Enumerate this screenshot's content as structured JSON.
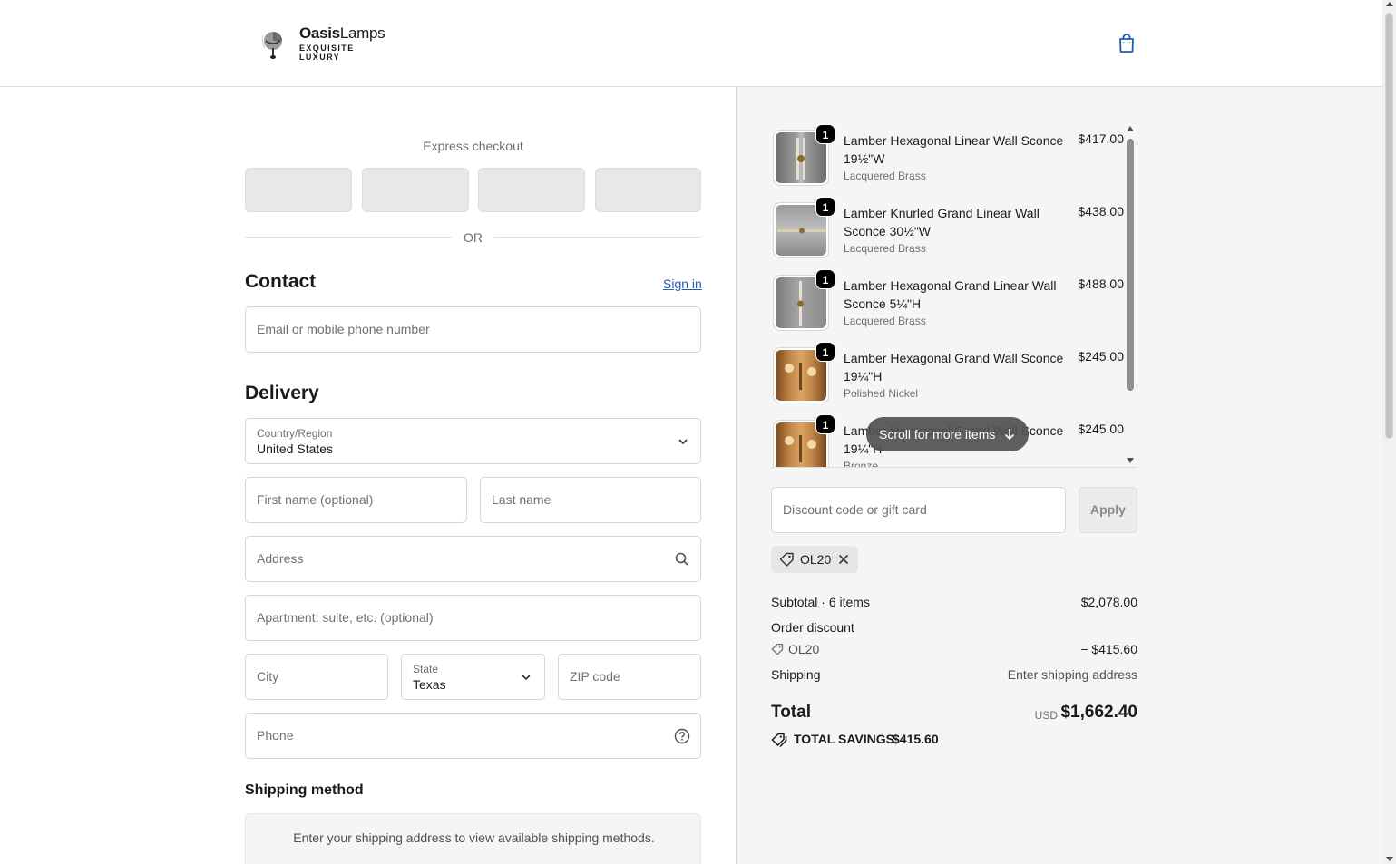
{
  "brand": {
    "name_bold": "Oasis",
    "name_light": "Lamps",
    "tagline_1": "EXQUISITE",
    "tagline_2": "LUXURY"
  },
  "express": {
    "label": "Express checkout",
    "or": "OR"
  },
  "contact": {
    "title": "Contact",
    "sign_in": "Sign in",
    "email_placeholder": "Email or mobile phone number"
  },
  "delivery": {
    "title": "Delivery",
    "country_label": "Country/Region",
    "country_value": "United States",
    "first_name_placeholder": "First name (optional)",
    "last_name_placeholder": "Last name",
    "address_placeholder": "Address",
    "apartment_placeholder": "Apartment, suite, etc. (optional)",
    "city_placeholder": "City",
    "state_label": "State",
    "state_value": "Texas",
    "zip_placeholder": "ZIP code",
    "phone_placeholder": "Phone"
  },
  "shipping_method": {
    "title": "Shipping method",
    "message": "Enter your shipping address to view available shipping methods."
  },
  "cart": {
    "items": [
      {
        "name": "Lamber Hexagonal Linear Wall Sconce 19½\"W",
        "variant": "Lacquered Brass",
        "price": "$417.00",
        "qty": "1"
      },
      {
        "name": "Lamber Knurled Grand Linear Wall Sconce 30½\"W",
        "variant": "Lacquered Brass",
        "price": "$438.00",
        "qty": "1"
      },
      {
        "name": "Lamber Hexagonal Grand Linear Wall Sconce 5¼\"H",
        "variant": "Lacquered Brass",
        "price": "$488.00",
        "qty": "1"
      },
      {
        "name": "Lamber Hexagonal Grand Wall Sconce 19¼\"H",
        "variant": "Polished Nickel",
        "price": "$245.00",
        "qty": "1"
      },
      {
        "name": "Lamber Hexagonal Grand Wall Sconce 19¼\"H",
        "variant": "Bronze",
        "price": "$245.00",
        "qty": "1"
      }
    ],
    "scroll_hint": "Scroll for more items"
  },
  "discount": {
    "placeholder": "Discount code or gift card",
    "apply": "Apply",
    "applied_code": "OL20"
  },
  "totals": {
    "subtotal_label": "Subtotal · 6 items",
    "subtotal_value": "$2,078.00",
    "order_discount_label": "Order discount",
    "discount_code": "OL20",
    "discount_value": "− $415.60",
    "shipping_label": "Shipping",
    "shipping_value": "Enter shipping address",
    "total_label": "Total",
    "currency": "USD",
    "total_value": "$1,662.40",
    "savings_label": "TOTAL SAVINGS",
    "savings_value": "$415.60"
  },
  "colors": {
    "link": "#1f5db5",
    "summary_bg": "#f5f5f5",
    "accent_bag": "#1f5db5"
  }
}
